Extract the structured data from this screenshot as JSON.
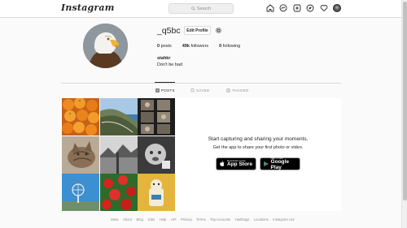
{
  "nav": {
    "logo": "Instagram",
    "search_placeholder": "Search",
    "icons": [
      "home-icon",
      "messenger-icon",
      "new-post-icon",
      "explore-icon",
      "activity-heart-icon",
      "profile-avatar"
    ]
  },
  "profile": {
    "username": "_q5bc",
    "edit_label": "Edit Profile",
    "posts_count": "0",
    "posts_label": "posts",
    "followers_count": "49k",
    "followers_label": "followers",
    "following_count": "0",
    "following_label": "following",
    "full_name": "stahkr",
    "bio": "Don't be bad"
  },
  "tabs": [
    {
      "label": "POSTS",
      "active": true
    },
    {
      "label": "SAVED",
      "active": false
    },
    {
      "label": "TAGGED",
      "active": false
    }
  ],
  "promo": {
    "title": "Start capturing and sharing your moments.",
    "subtitle": "Get the app to share your first photo or video.",
    "appstore_small": "Download on the",
    "appstore_big": "App Store",
    "gplay_small": "GET IT ON",
    "gplay_big": "Google Play"
  },
  "footer": [
    "Meta",
    "About",
    "Blog",
    "Jobs",
    "Help",
    "API",
    "Privacy",
    "Terms",
    "Top Accounts",
    "Hashtags",
    "Locations",
    "Instagram Lite"
  ],
  "colors": {
    "background": "#fafafa",
    "text": "#262626",
    "muted": "#8e8e8e",
    "border": "#dbdbdb"
  }
}
